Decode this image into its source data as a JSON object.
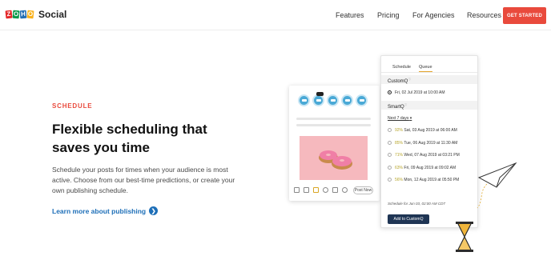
{
  "brand": {
    "logo_letters": [
      "Z",
      "O",
      "H",
      "O"
    ],
    "logo_letter_colors": [
      "#e42527",
      "#089949",
      "#226db4",
      "#f9b21d"
    ],
    "product": "Social"
  },
  "nav": {
    "items": [
      "Features",
      "Pricing",
      "For Agencies",
      "Resources"
    ],
    "cta": "GET STARTED",
    "cta_color": "#e94a3c"
  },
  "hero": {
    "eyebrow": "SCHEDULE",
    "headline": "Flexible scheduling that saves you time",
    "description": "Schedule your posts for times when your audience is most active. Choose from our best-time predictions, or create your own publishing schedule.",
    "link": "Learn more about publishing",
    "link_icon": "arrow-right-circle-icon"
  },
  "composer": {
    "post_button": "Post Now",
    "toolbar_icons": [
      "camera-icon",
      "gif-icon",
      "scissors-icon",
      "emoji-icon",
      "calendar-icon",
      "preview-icon"
    ]
  },
  "schedule_panel": {
    "tabs": [
      "Schedule",
      "Queue"
    ],
    "active_tab": "Queue",
    "custom_section": "CustomQ",
    "custom_slot": "Fri, 02 Jul 2019 at 10:00 AM",
    "smart_section": "SmartQ",
    "next_label": "Next 7 days",
    "smart_slots": [
      {
        "pct": "92%",
        "time": "Sat, 03 Aug 2019 at 06:00 AM"
      },
      {
        "pct": "85%",
        "time": "Tue, 06 Aug 2019 at 11:30 AM"
      },
      {
        "pct": "71%",
        "time": "Wed, 07 Aug 2019 at 03:21 PM"
      },
      {
        "pct": "63%",
        "time": "Fri, 09 Aug 2019 at 09:02 AM"
      },
      {
        "pct": "56%",
        "time": "Mon, 12 Aug 2019 at 05:50 PM"
      }
    ],
    "schedule_note": "Schedule for Jun 03, 02:00 AM  CDT",
    "add_button": "Add to CustomQ"
  }
}
